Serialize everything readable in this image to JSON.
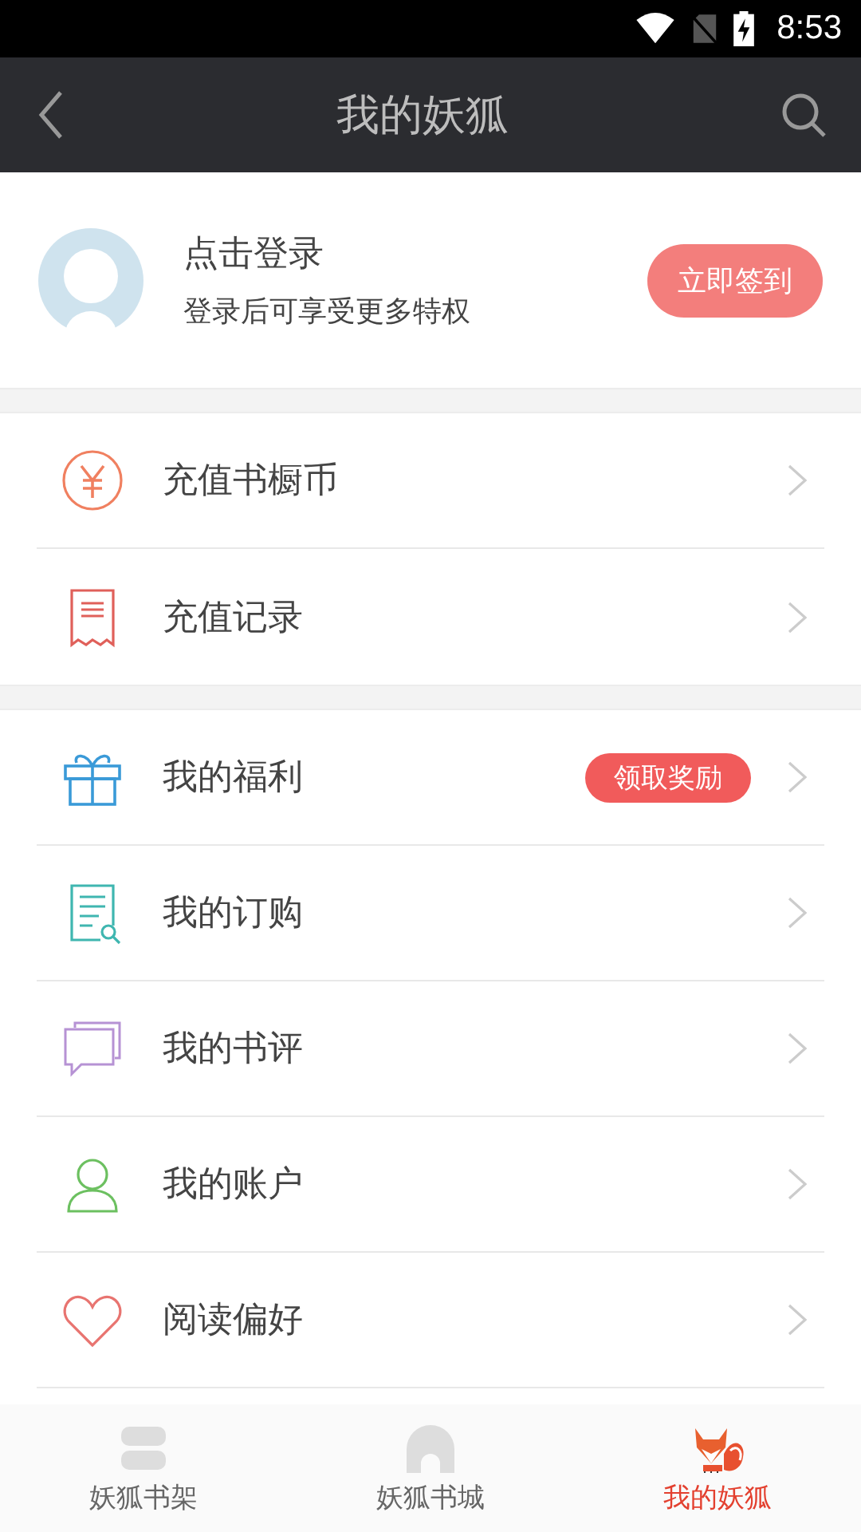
{
  "status_bar": {
    "time": "8:53"
  },
  "header": {
    "title": "我的妖狐"
  },
  "profile": {
    "name": "点击登录",
    "subtitle": "登录后可享受更多特权",
    "checkin_button": "立即签到"
  },
  "sections": [
    {
      "items": [
        {
          "label": "充值书橱币"
        },
        {
          "label": "充值记录"
        }
      ]
    },
    {
      "items": [
        {
          "label": "我的福利",
          "badge": "领取奖励"
        },
        {
          "label": "我的订购"
        },
        {
          "label": "我的书评"
        },
        {
          "label": "我的账户"
        },
        {
          "label": "阅读偏好"
        }
      ]
    }
  ],
  "tab_bar": [
    {
      "label": "妖狐书架",
      "selected": false
    },
    {
      "label": "妖狐书城",
      "selected": false
    },
    {
      "label": "我的妖狐",
      "selected": true
    }
  ]
}
